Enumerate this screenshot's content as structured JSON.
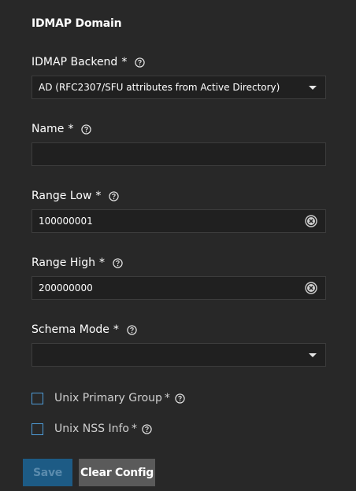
{
  "section": {
    "title": "IDMAP Domain"
  },
  "fields": {
    "backend": {
      "label": "IDMAP Backend",
      "required": "*",
      "value": "AD (RFC2307/SFU attributes from Active Directory)"
    },
    "name": {
      "label": "Name",
      "required": "*",
      "value": ""
    },
    "range_low": {
      "label": "Range Low",
      "required": "*",
      "value": "100000001"
    },
    "range_high": {
      "label": "Range High",
      "required": "*",
      "value": "200000000"
    },
    "schema_mode": {
      "label": "Schema Mode",
      "required": "*",
      "value": ""
    }
  },
  "checkboxes": {
    "unix_primary_group": {
      "label": "Unix Primary Group",
      "required": "*",
      "checked": false
    },
    "unix_nss_info": {
      "label": "Unix NSS Info",
      "required": "*",
      "checked": false
    }
  },
  "buttons": {
    "save": "Save",
    "clear_config": "Clear Config"
  },
  "colors": {
    "background": "#282828",
    "input_bg": "#202020",
    "accent": "#4e9cd8",
    "save_bg": "#1d5b85",
    "clear_bg": "#5a5a5a"
  }
}
